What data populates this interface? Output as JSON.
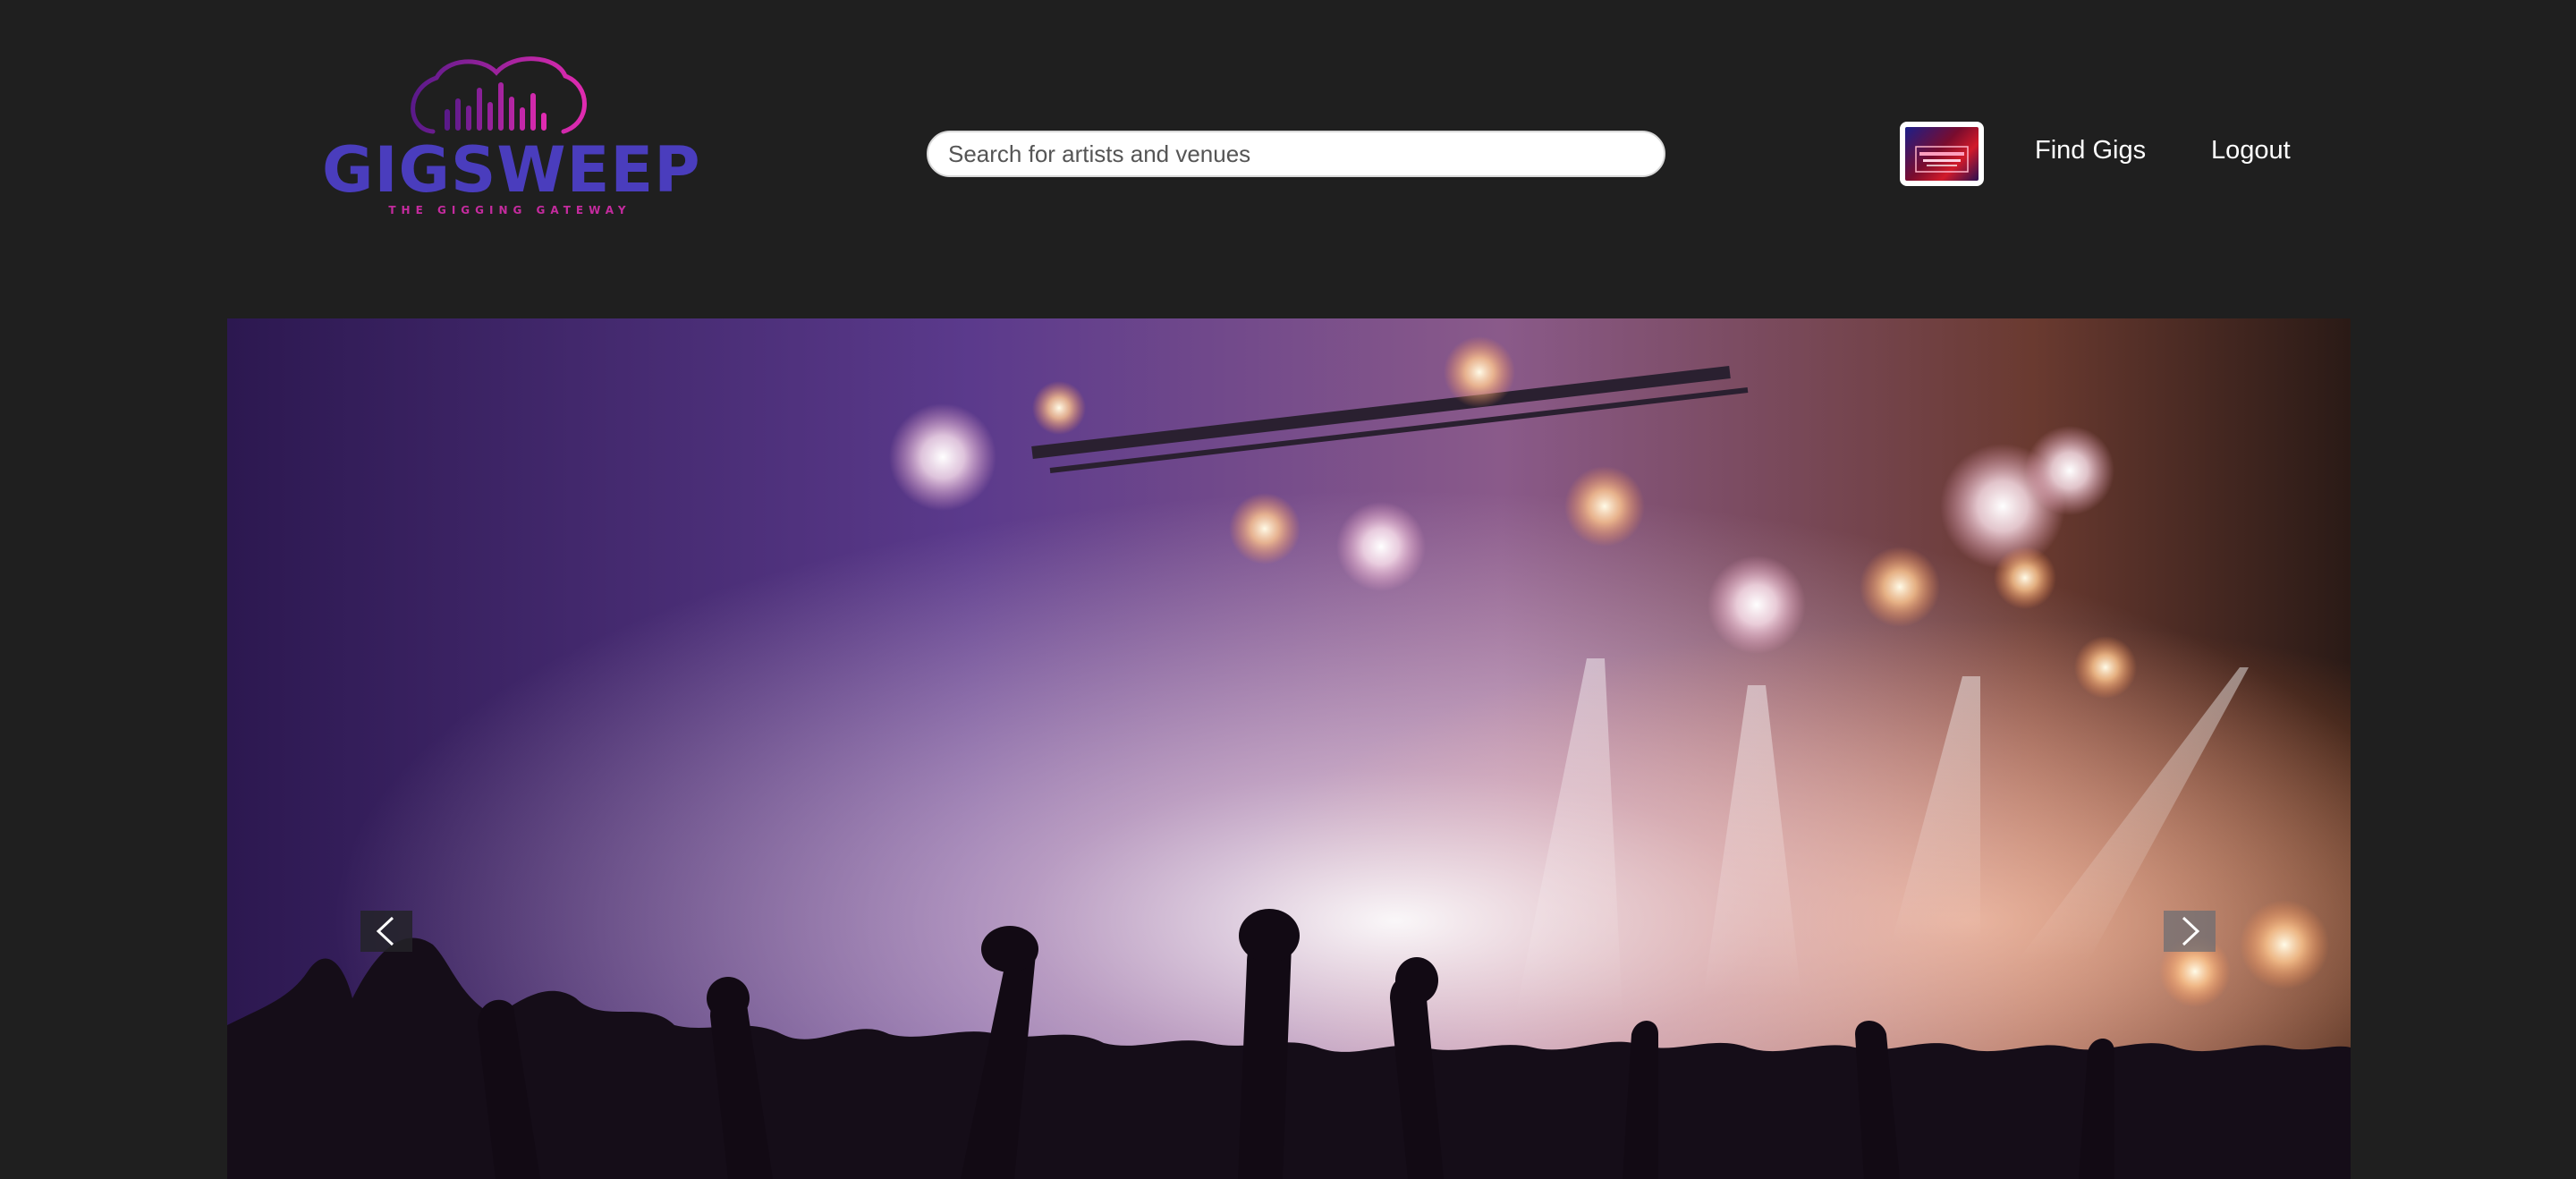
{
  "brand": {
    "name": "GIGSWEEP",
    "tagline": "THE GIGGING GATEWAY",
    "colors": {
      "word": "#4a3dbd",
      "accent": "#d42aa7",
      "tagline": "#c42b9e"
    }
  },
  "search": {
    "placeholder": "Search for artists and venues",
    "value": ""
  },
  "nav": {
    "find_gigs": "Find Gigs",
    "logout": "Logout"
  },
  "avatar": {
    "icon": "profile-picture"
  },
  "carousel": {
    "prev_icon": "chevron-left-icon",
    "next_icon": "chevron-right-icon"
  },
  "theme": {
    "background": "#1f1f1f",
    "text": "#ffffff"
  }
}
